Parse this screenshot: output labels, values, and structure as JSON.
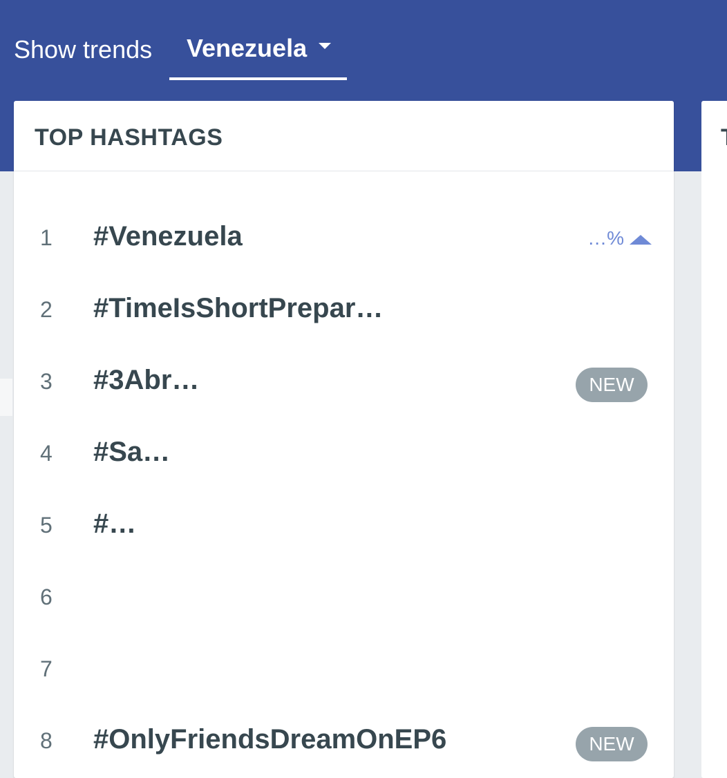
{
  "header": {
    "show_label": "Show trends",
    "country": "Venezuela"
  },
  "card": {
    "title": "TOP HASHTAGS",
    "items": [
      {
        "rank": "1",
        "tag": "#Venezuela",
        "badge": "",
        "percent": "…%"
      },
      {
        "rank": "2",
        "tag": "#TimeIsShortPrepar…",
        "badge": "",
        "percent": ""
      },
      {
        "rank": "3",
        "tag": "#3Abr…",
        "badge": "NEW",
        "percent": ""
      },
      {
        "rank": "4",
        "tag": "#Sa…",
        "badge": "",
        "percent": ""
      },
      {
        "rank": "5",
        "tag": "#…",
        "badge": "",
        "percent": ""
      },
      {
        "rank": "6",
        "tag": "",
        "badge": "",
        "percent": ""
      },
      {
        "rank": "7",
        "tag": "",
        "badge": "",
        "percent": ""
      },
      {
        "rank": "8",
        "tag": "#OnlyFriendsDreamOnEP6",
        "badge": "NEW",
        "percent": ""
      }
    ]
  },
  "second_card": {
    "title_partial": "T"
  },
  "colors": {
    "header_bg": "#37509b",
    "badge_bg": "#97a4ab",
    "trend_up": "#6f8ad6",
    "text_dark": "#37474f"
  }
}
